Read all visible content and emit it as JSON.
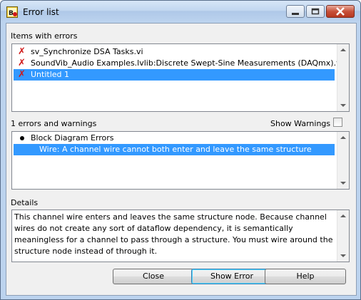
{
  "window": {
    "title": "Error list",
    "icon": "labview-app-icon",
    "controls": [
      "minimize",
      "maximize",
      "close"
    ]
  },
  "items_section": {
    "label": "Items with errors",
    "items": [
      {
        "text": "sv_Synchronize DSA Tasks.vi",
        "icon": "error-x-icon",
        "selected": false
      },
      {
        "text": "SoundVib_Audio Examples.lvlib:Discrete Swept-Sine Measurements (DAQmx).vi",
        "icon": "error-x-icon",
        "selected": false
      },
      {
        "text": "Untitled 1",
        "icon": "error-x-icon",
        "selected": true
      }
    ]
  },
  "errors_section": {
    "count_label": "1 errors and warnings",
    "show_warnings_label": "Show Warnings",
    "show_warnings_checked": false,
    "tree": [
      {
        "text": "Block Diagram Errors",
        "type": "group"
      },
      {
        "text": "Wire: A channel wire cannot both enter and leave the same structure",
        "type": "error",
        "selected": true
      }
    ]
  },
  "details": {
    "label": "Details",
    "text": "This channel wire enters and leaves the same structure node. Because channel wires do not create any sort of dataflow dependency, it is semantically meaningless for a channel to pass through a structure. You must wire around the structure node instead of through it."
  },
  "buttons": {
    "close": "Close",
    "show_error": "Show Error",
    "help": "Help"
  },
  "colors": {
    "selection": "#3399ff",
    "error_icon": "#d01818",
    "title_bar": "#bcd3ee"
  }
}
